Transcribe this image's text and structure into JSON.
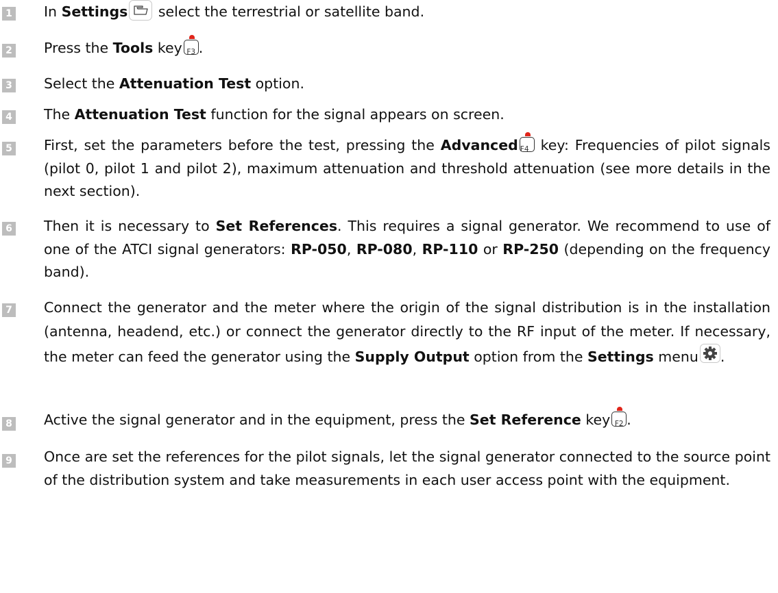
{
  "steps": [
    {
      "n": "1",
      "t1": "In ",
      "b1": "Settings",
      "t2": " select the terrestrial or satellite band.",
      "icon": "folder-icon"
    },
    {
      "n": "2",
      "t1": "Press the ",
      "b1": "Tools",
      "t2": " key",
      "t3": ".",
      "key": "F3"
    },
    {
      "n": "3",
      "t1": "Select the ",
      "b1": "Attenuation Test",
      "t2": " option."
    },
    {
      "n": "4",
      "t1": "The ",
      "b1": "Attenuation Test",
      "t2": " function for the signal appears on screen."
    },
    {
      "n": "5",
      "t1": "First, set the parameters before the test, pressing the ",
      "b1": "Advanced",
      "key": "F4",
      "t2": " key: Frequencies of pilot signals (pilot 0, pilot 1 and pilot 2), maximum attenuation and threshold attenuation (see more details in the next section)."
    },
    {
      "n": "6",
      "t1": "Then it is necessary to ",
      "b1": "Set References",
      "t2": ". This requires a signal generator. We recommend to use of one of the ATCI signal generators: ",
      "b2": "RP-050",
      "t3": ", ",
      "b3": "RP-080",
      "t4": ", ",
      "b4": "RP-110",
      "t5": " or ",
      "b5": "RP-250",
      "t6": " (depending on the frequency band)."
    },
    {
      "n": "7",
      "t1": "Connect the generator and the meter where the origin of the signal distribution is in the installation (antenna, headend, etc.) or connect the generator directly to the RF input of the meter. If necessary, the meter can feed the generator using the ",
      "b1": "Supply Output",
      "t2": " option from the ",
      "b2": "Settings",
      "t3": " menu",
      "t4": ".",
      "icon": "gear-icon"
    },
    {
      "n": "8",
      "t1": "Active the signal generator and in the equipment, press the ",
      "b1": "Set Reference",
      "t2": " key",
      "t3": ".",
      "key": "F2"
    },
    {
      "n": "9",
      "t1": "Once are set the references for the pilot signals, let the signal generator connected to the source point of the distribution system and take measurements in each user access point with the equipment."
    }
  ],
  "colors": {
    "number_badge": "#bdbdbd",
    "key_dot": "#e0251a",
    "text": "#111111"
  }
}
